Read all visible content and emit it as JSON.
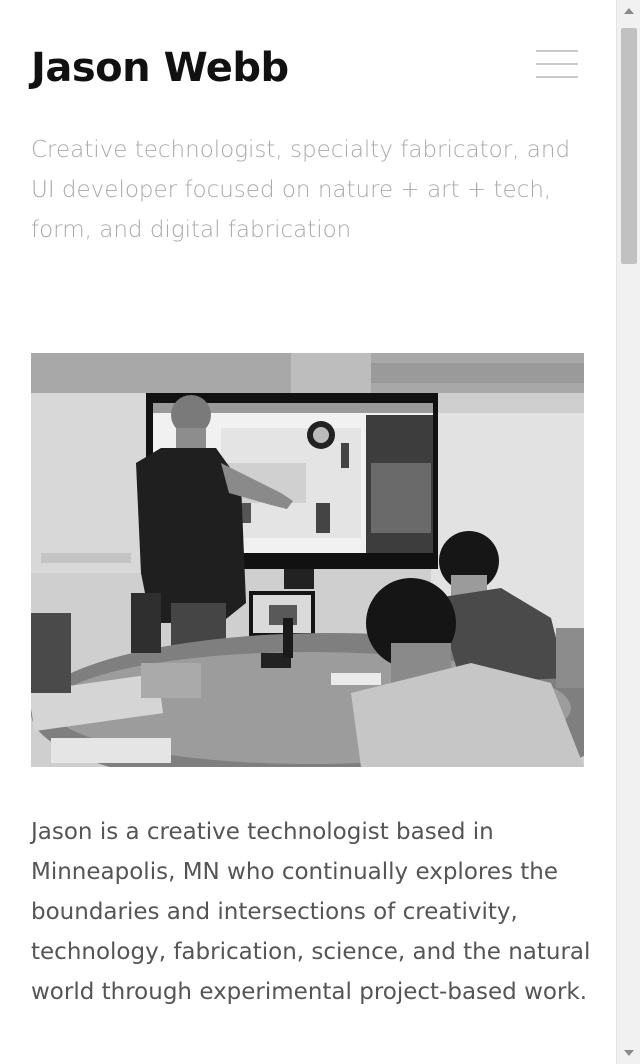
{
  "header": {
    "title": "Jason Webb",
    "menu_icon": "hamburger-menu-icon"
  },
  "intro": {
    "tagline": "Creative technologist, specialty fabricator, and UI developer focused on nature + art + tech, form, and digital fabrication"
  },
  "hero": {
    "image": "photo-presentation"
  },
  "about": {
    "bio": "Jason is a creative technologist based in Minneapolis, MN who continually explores the boundaries and intersections of creativity, technology, fabrication, science, and the natural world through experimental project-based work."
  },
  "colors": {
    "title": "#111111",
    "tagline": "#a9a9a9",
    "body": "#555555",
    "menu": "#c9c9c9"
  }
}
